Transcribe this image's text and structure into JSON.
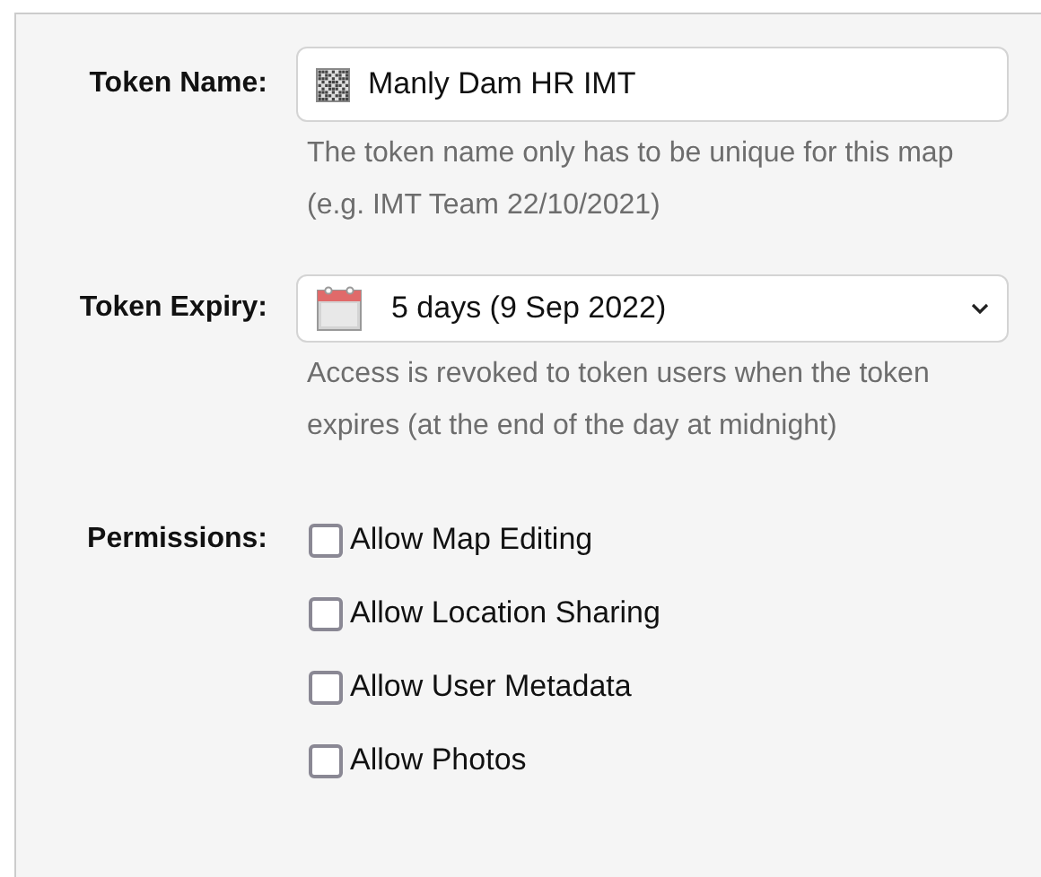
{
  "token_name": {
    "label": "Token Name:",
    "value": "Manly Dam HR IMT",
    "hint": "The token name only has to be unique for this map (e.g. IMT Team 22/10/2021)"
  },
  "token_expiry": {
    "label": "Token Expiry:",
    "value": "5 days (9 Sep 2022)",
    "hint": "Access is revoked to token users when the token expires (at the end of the day at midnight)"
  },
  "permissions": {
    "label": "Permissions:",
    "options": [
      {
        "label": "Allow Map Editing",
        "checked": false
      },
      {
        "label": "Allow Location Sharing",
        "checked": false
      },
      {
        "label": "Allow User Metadata",
        "checked": false
      },
      {
        "label": "Allow Photos",
        "checked": false
      }
    ]
  }
}
